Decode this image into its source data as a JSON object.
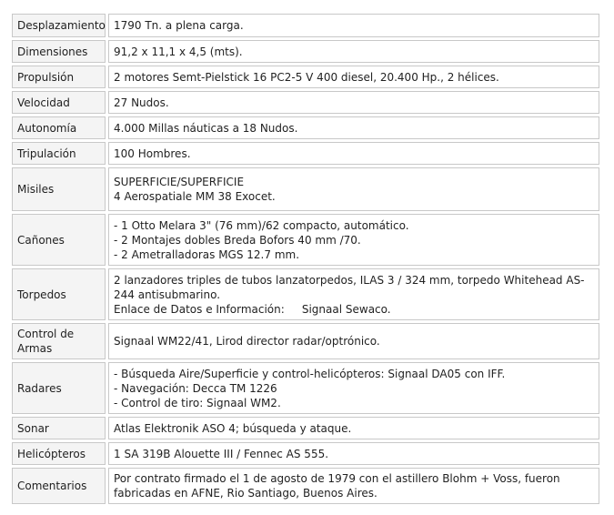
{
  "rows": [
    {
      "label": "Desplazamiento",
      "value": [
        "1790 Tn. a plena carga."
      ]
    },
    {
      "label": "Dimensiones",
      "value": [
        "91,2 x 11,1 x 4,5 (mts)."
      ]
    },
    {
      "label": "Propulsión",
      "value": [
        "2 motores Semt-Pielstick 16 PC2-5 V 400 diesel, 20.400 Hp., 2 hélices."
      ]
    },
    {
      "label": "Velocidad",
      "value": [
        "27 Nudos."
      ]
    },
    {
      "label": "Autonomía",
      "value": [
        "4.000 Millas náuticas a 18 Nudos."
      ]
    },
    {
      "label": "Tripulación",
      "value": [
        "100 Hombres."
      ]
    },
    {
      "label": "Misiles",
      "value": [
        "SUPERFICIE/SUPERFICIE",
        "4 Aerospatiale MM 38 Exocet."
      ]
    },
    {
      "label": "Cañones",
      "value": [
        "- 1 Otto Melara 3\" (76 mm)/62 compacto, automático.",
        "- 2 Montajes dobles Breda Bofors 40 mm /70.",
        "- 2 Ametralladoras MGS 12.7 mm."
      ]
    },
    {
      "label": "Torpedos",
      "value": [
        "2 lanzadores triples de tubos lanzatorpedos, ILAS 3 / 324 mm, torpedo Whitehead AS-244 antisubmarino.",
        "Enlace de Datos e Información:     Signaal Sewaco."
      ]
    },
    {
      "label": "Control de Armas",
      "value": [
        "Signaal WM22/41, Lirod director radar/optrónico."
      ]
    },
    {
      "label": "Radares",
      "value": [
        "- Búsqueda Aire/Superficie y control-helicópteros: Signaal DA05 con IFF.",
        "- Navegación: Decca TM 1226",
        "- Control de tiro: Signaal WM2."
      ]
    },
    {
      "label": "Sonar",
      "value": [
        "Atlas Elektronik ASO 4; búsqueda y ataque."
      ]
    },
    {
      "label": "Helicópteros",
      "value": [
        "1 SA 319B Alouette III / Fennec AS 555."
      ]
    },
    {
      "label": "Comentarios",
      "value": [
        "Por contrato firmado el 1 de agosto de 1979 con el astillero Blohm + Voss, fueron fabricadas en AFNE, Rio Santiago, Buenos Aires."
      ]
    }
  ]
}
